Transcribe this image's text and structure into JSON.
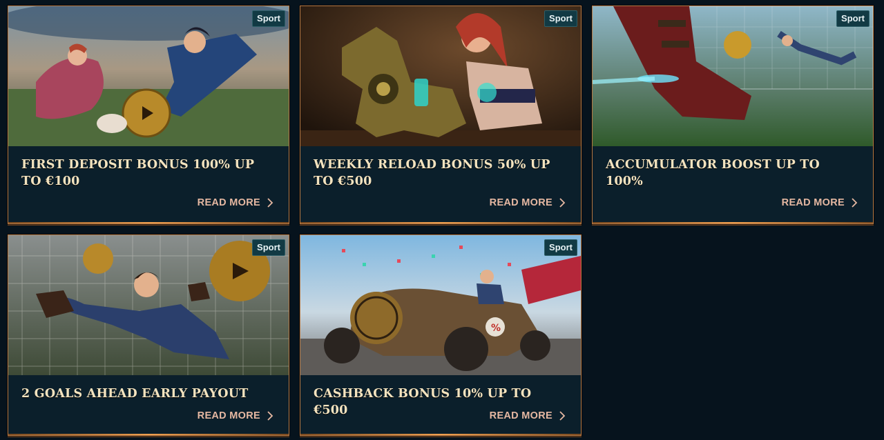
{
  "promos": [
    {
      "badge": "Sport",
      "title": "First Deposit Bonus 100% up to €100",
      "cta": "READ MORE",
      "icon": "chevron-right-icon"
    },
    {
      "badge": "Sport",
      "title": "Weekly Reload Bonus 50% up to €500",
      "cta": "READ MORE",
      "icon": "chevron-right-icon"
    },
    {
      "badge": "Sport",
      "title": "Accumulator Boost up to 100%",
      "cta": "READ MORE",
      "icon": "chevron-right-icon"
    },
    {
      "badge": "Sport",
      "title": "2 Goals Ahead Early Payout",
      "cta": "READ MORE",
      "icon": "chevron-right-icon"
    },
    {
      "badge": "Sport",
      "title": "Cashback Bonus 10% up to €500",
      "cta": "READ MORE",
      "icon": "chevron-right-icon"
    }
  ],
  "colors": {
    "background": "#06131d",
    "card": "#0b1f2b",
    "border": "#b77a45",
    "title": "#f3e3bf",
    "cta": "#e6b8a2",
    "badge": "#123a44"
  }
}
